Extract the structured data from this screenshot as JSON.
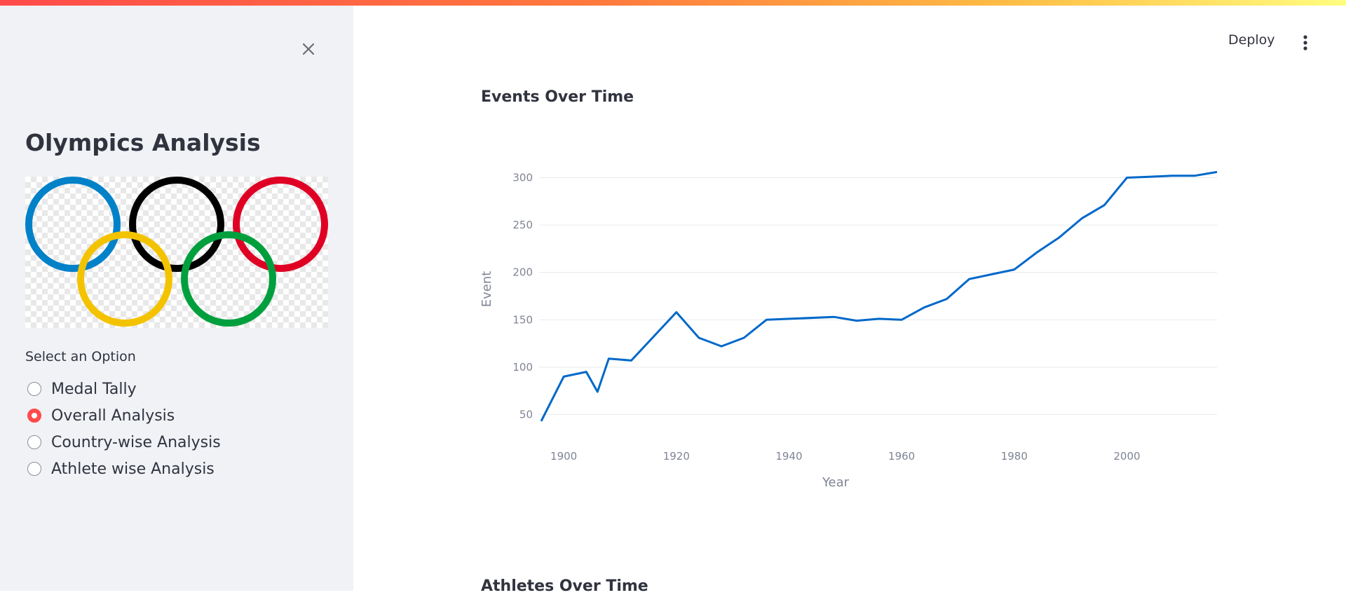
{
  "sidebar": {
    "title": "Olympics Analysis",
    "select_label": "Select an Option",
    "options": [
      "Medal Tally",
      "Overall Analysis",
      "Country-wise Analysis",
      "Athlete wise Analysis"
    ],
    "selected": "Overall Analysis"
  },
  "header": {
    "deploy_label": "Deploy"
  },
  "main": {
    "chart_title": "Events Over Time",
    "next_section_title": "Athletes Over Time"
  },
  "colors": {
    "accent": "#ff4b4b",
    "line": "#0068c9",
    "sidebar_bg": "#f0f2f6",
    "ring_blue": "#0081c8",
    "ring_yellow": "#fcb131",
    "ring_black": "#000000",
    "ring_green": "#00a651",
    "ring_red": "#ee334e"
  },
  "icons": {
    "close": "close-icon",
    "menu": "kebab-menu-icon",
    "logo": "olympic-rings-logo"
  },
  "chart_data": {
    "type": "line",
    "title": "Events Over Time",
    "xlabel": "Year",
    "ylabel": "Event",
    "x": [
      1896,
      1900,
      1904,
      1906,
      1908,
      1912,
      1920,
      1924,
      1928,
      1932,
      1936,
      1948,
      1952,
      1956,
      1960,
      1964,
      1968,
      1972,
      1976,
      1980,
      1984,
      1988,
      1992,
      1996,
      2000,
      2004,
      2008,
      2012,
      2016
    ],
    "values": [
      43,
      90,
      95,
      74,
      109,
      107,
      158,
      131,
      122,
      131,
      150,
      153,
      149,
      151,
      150,
      163,
      172,
      193,
      198,
      203,
      221,
      237,
      257,
      271,
      300,
      301,
      302,
      302,
      306
    ],
    "xticks": [
      1900,
      1920,
      1940,
      1960,
      1980,
      2000
    ],
    "yticks": [
      50,
      100,
      150,
      200,
      250,
      300
    ],
    "xlim": [
      1896,
      2016
    ],
    "ylim": [
      40,
      310
    ],
    "grid": true
  }
}
